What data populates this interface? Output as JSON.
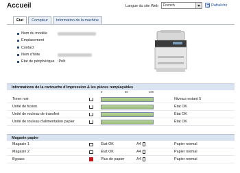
{
  "page": {
    "title": "Accueil"
  },
  "header": {
    "language_label": "Langue du site Web",
    "language_value": "French",
    "refresh_label": "Rafraîchir"
  },
  "tabs": [
    {
      "label": "État",
      "active": true
    },
    {
      "label": "Compteur",
      "active": false
    },
    {
      "label": "Information de la machine",
      "active": false
    }
  ],
  "device_info": [
    {
      "label": "Nom du modèle",
      "value": ""
    },
    {
      "label": "Emplacement",
      "value": ""
    },
    {
      "label": "Contact",
      "value": ""
    },
    {
      "label": "Nom d'hôte",
      "value": ""
    },
    {
      "label": "État de périphérique",
      "value": ":Prêt"
    }
  ],
  "cartridge": {
    "heading": "Informations de la cartouche d'impression & les pièces remplaçables",
    "scale_labels": [
      "0",
      "50",
      "100"
    ],
    "items": [
      {
        "label": "Toner noir",
        "level_percent": 100,
        "status": "Niveau restant 5"
      },
      {
        "label": "Unité de fusion",
        "level_percent": 100,
        "status": "État OK"
      },
      {
        "label": "Unité de rouleau de transfert",
        "level_percent": 100,
        "status": "État OK"
      },
      {
        "label": "Unité de rouleau d'alimentation papier",
        "level_percent": 100,
        "status": "État OK"
      }
    ]
  },
  "paper": {
    "heading": "Magasin papier",
    "items": [
      {
        "label": "Magasin 1",
        "status": "État OK",
        "size": "A4",
        "type": "Papier normal",
        "alert": false
      },
      {
        "label": "Magasin 2",
        "status": "État OK",
        "size": "A4",
        "type": "Papier normal",
        "alert": false
      },
      {
        "label": "Bypass",
        "status": "Plus de papier",
        "size": "A4",
        "type": "Papier normal",
        "alert": true
      }
    ]
  }
}
